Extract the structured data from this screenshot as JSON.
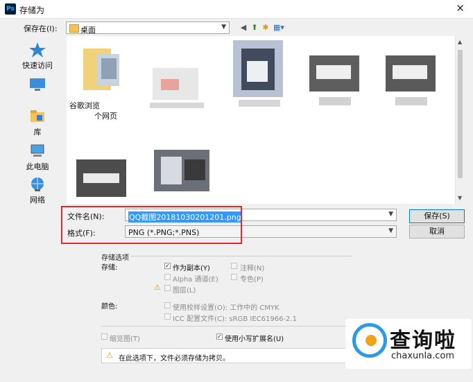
{
  "window": {
    "app_icon": "Ps",
    "title": "存储为",
    "close": "✕"
  },
  "toolbar": {
    "save_in_label": "保存在(I):",
    "location": "桌面",
    "icons": [
      "back-icon",
      "up-folder-icon",
      "new-folder-icon",
      "view-menu-icon"
    ]
  },
  "places": [
    {
      "label": "快速访问",
      "icon": "star-icon"
    },
    {
      "label": "桌面",
      "icon": "desktop-icon"
    },
    {
      "label": "库",
      "icon": "library-icon"
    },
    {
      "label": "此电脑",
      "icon": "computer-icon"
    },
    {
      "label": "网络",
      "icon": "network-icon"
    }
  ],
  "files": [
    {
      "caption": "谷歌浏览",
      "caption2": "个网页"
    },
    {
      "caption": ""
    },
    {
      "caption": ""
    },
    {
      "caption": ""
    },
    {
      "caption": ""
    },
    {
      "caption": ""
    },
    {
      "caption": ""
    }
  ],
  "form": {
    "filename_label": "文件名(N):",
    "filename_value": "QQ截图20181030201201.png",
    "format_label": "格式(F):",
    "format_value": "PNG (*.PNG;*.PNS)",
    "save_button": "保存(S)",
    "cancel_button": "取消"
  },
  "options": {
    "group_title": "存储选项",
    "save_label": "存储:",
    "as_copy": "作为副本(Y)",
    "as_copy_checked": true,
    "notes": "注释(N)",
    "alpha": "Alpha 通道(E)",
    "spot": "专色(P)",
    "layers": "图层(L)",
    "color_label": "颜色:",
    "proof": "使用校样设置(O): 工作中的 CMYK",
    "icc": "ICC 配置文件(C): sRGB IEC61966-2.1",
    "thumbnail": "缩览图(T)",
    "lowercase_ext": "使用小写扩展名(U)",
    "lowercase_ext_checked": true,
    "warning": "在此选项下，文件必须存储为拷贝。"
  },
  "watermark": {
    "text": "查询啦",
    "sub": "chaxunla.com"
  },
  "colors": {
    "highlight": "#3399ff",
    "accent_red": "#e0282e",
    "wm_blue": "#2d9ae8",
    "wm_orange": "#f0a21b"
  }
}
